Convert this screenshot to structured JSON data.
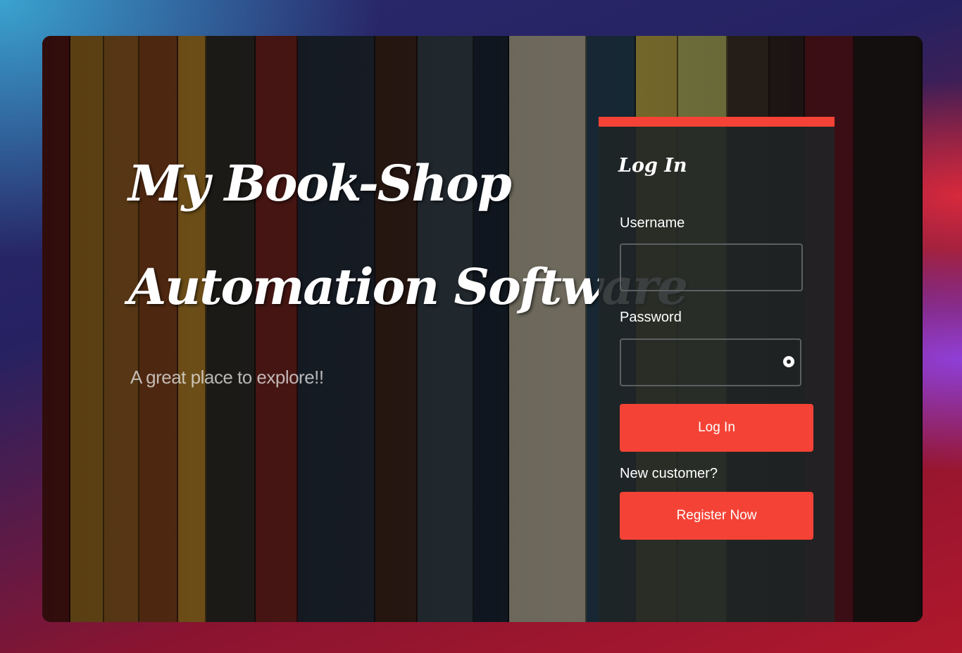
{
  "hero": {
    "title_line1": "My Book-Shop",
    "title_line2": "Automation Software",
    "tagline": "A great place to explore!!"
  },
  "login": {
    "title": "Log In",
    "username_label": "Username",
    "username_value": "",
    "password_label": "Password",
    "password_value": "",
    "password_toggle_icon": "eye-icon",
    "login_button": "Log In",
    "new_customer": "New customer?",
    "register_button": "Register Now"
  },
  "colors": {
    "accent": "#f44336",
    "panel": "#202426",
    "text": "#ffffff"
  }
}
